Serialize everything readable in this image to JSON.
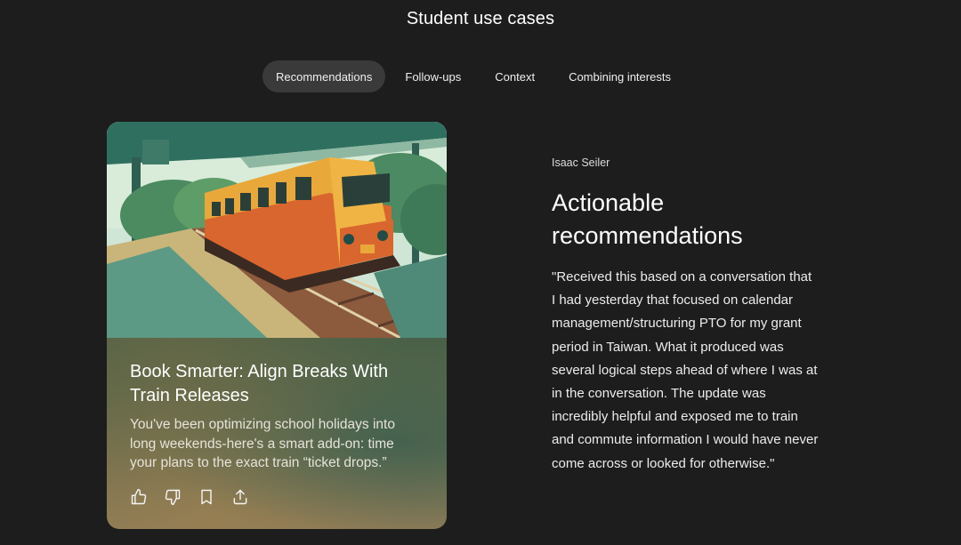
{
  "page": {
    "title": "Student use cases"
  },
  "tabs": [
    {
      "label": "Recommendations",
      "active": true
    },
    {
      "label": "Follow-ups",
      "active": false
    },
    {
      "label": "Context",
      "active": false
    },
    {
      "label": "Combining interests",
      "active": false
    }
  ],
  "card": {
    "illustration": "train-at-station-illustration",
    "title": "Book Smarter: Align Breaks With Train Releases",
    "body": "You've been optimizing school holidays into long weekends-here's a smart add-on: time your plans to the exact train “ticket drops.”",
    "actions": [
      {
        "icon": "thumbs-up-icon"
      },
      {
        "icon": "thumbs-down-icon"
      },
      {
        "icon": "bookmark-icon"
      },
      {
        "icon": "share-icon"
      }
    ]
  },
  "testimonial": {
    "author": "Isaac Seiler",
    "headline": "Actionable recommendations",
    "quote": "\"Received this based on a conversation that I had yesterday that focused on calendar management/structuring PTO for my grant period in Taiwan. What it produced was several logical steps ahead of where I was at in the conversation. The update was incredibly helpful and exposed me to train and commute information I would have never come across or looked for otherwise.\""
  },
  "colors": {
    "background": "#1d1d1d",
    "active_tab": "#3a3a3a",
    "train_yellow": "#e9a83a",
    "train_orange": "#d9662e",
    "teal": "#3f7f73"
  }
}
